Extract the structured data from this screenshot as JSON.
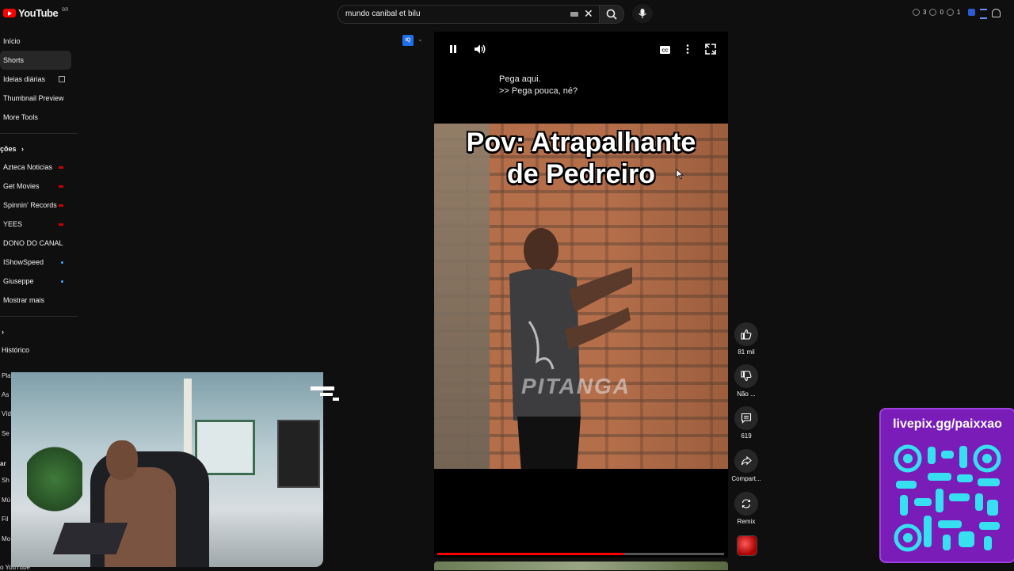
{
  "header": {
    "logo_text": "YouTube",
    "logo_country": "BR",
    "search_value": "mundo canibal et bilu",
    "stats": [
      "3",
      "0",
      "1"
    ]
  },
  "sidebar": {
    "main": [
      {
        "label": "Início"
      },
      {
        "label": "Shorts",
        "active": true
      },
      {
        "label": "Ideias diárias",
        "external": true
      },
      {
        "label": "Thumbnail Preview"
      },
      {
        "label": "More Tools"
      }
    ],
    "subscriptions_heading": "ções",
    "channels": [
      {
        "label": "Azteca Noticias",
        "status": "live"
      },
      {
        "label": "Get Movies",
        "status": "live"
      },
      {
        "label": "Spinnin' Records",
        "status": "live"
      },
      {
        "label": "YEES",
        "status": "live"
      },
      {
        "label": "DONO DO CANAL",
        "status": ""
      },
      {
        "label": "IShowSpeed",
        "status": "new"
      },
      {
        "label": "Giuseppe",
        "status": "new"
      },
      {
        "label": "Mostrar mais",
        "status": ""
      }
    ],
    "history_label": "Histórico",
    "overflow_fragments": [
      "Playli",
      "As",
      "Víd",
      "Se",
      "ar",
      "Sh",
      "Mú",
      "Fil",
      "Mo",
      "o YouTube"
    ]
  },
  "player": {
    "caption_line1": "Pega aqui.",
    "caption_line2": ">> Pega pouca, né?",
    "overlay_title_line1": "Pov: Atrapalhante",
    "overlay_title_line2": "de Pedreiro",
    "watermark": "PITANGA",
    "progress_fraction": 0.65,
    "iq_badge": "IQ"
  },
  "actions": {
    "like_count": "81 mil",
    "dislike_label": "Não ...",
    "comments_count": "619",
    "share_label": "Compart...",
    "remix_label": "Remix"
  },
  "overlay": {
    "livepix_text": "livepix.gg/paixxao"
  },
  "colors": {
    "background": "#0f0f0f",
    "accent_red": "#ff0000",
    "livepix_purple": "#7a1cb8",
    "qr_cyan": "#36e0f0"
  }
}
